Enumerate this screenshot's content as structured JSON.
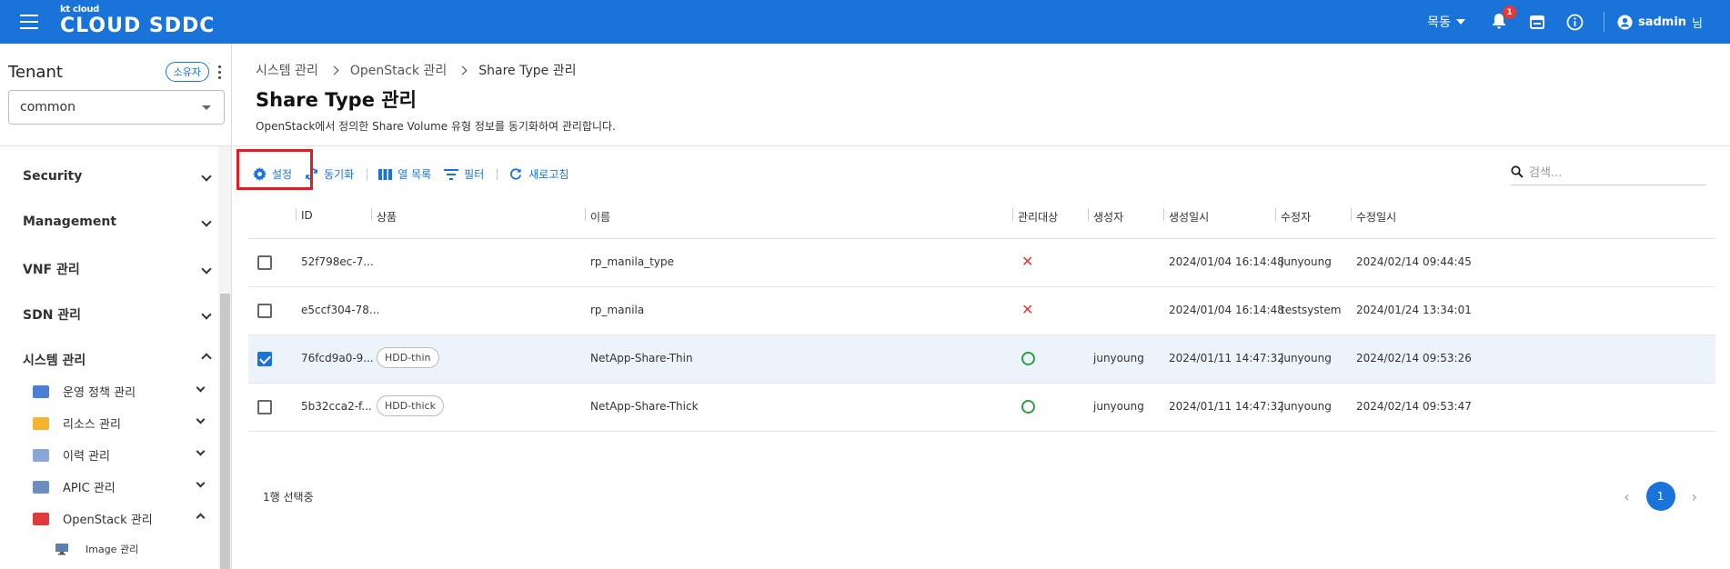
{
  "header": {
    "logo_small": "kt cloud",
    "logo_big": "CLOUD SDDC",
    "region": "목동",
    "notification_count": "1",
    "user_name": "sadmin",
    "user_suffix": "님"
  },
  "sidebar": {
    "tenant_title": "Tenant",
    "owner_chip": "소유자",
    "tenant_value": "common",
    "menus": [
      {
        "label": "Security"
      },
      {
        "label": "Management"
      },
      {
        "label": "VNF 관리"
      },
      {
        "label": "SDN 관리"
      },
      {
        "label": "시스템 관리"
      }
    ],
    "sub_items": [
      {
        "label": "운영 정책 관리",
        "icon": "policy-icon",
        "color": "#4a7fd4"
      },
      {
        "label": "리소스 관리",
        "icon": "folder-icon",
        "color": "#f2b431"
      },
      {
        "label": "이력 관리",
        "icon": "history-icon",
        "color": "#8aa6d6"
      },
      {
        "label": "APIC 관리",
        "icon": "monitor-icon",
        "color": "#6b8fbf"
      },
      {
        "label": "OpenStack 관리",
        "icon": "openstack-icon",
        "color": "#e03a3a"
      }
    ],
    "subsub_items": [
      {
        "label": "Image 관리",
        "icon": "image-icon"
      }
    ]
  },
  "breadcrumb": [
    "시스템 관리",
    "OpenStack 관리",
    "Share Type 관리"
  ],
  "page": {
    "title": "Share Type 관리",
    "description": "OpenStack에서 정의한 Share Volume 유형 정보를 동기화하여 관리합니다."
  },
  "toolbar": {
    "settings": "설정",
    "sync": "동기화",
    "columns": "열 목록",
    "filter": "필터",
    "refresh": "새로고침",
    "search_placeholder": "검색..."
  },
  "table": {
    "columns": [
      "ID",
      "상품",
      "이름",
      "관리대상",
      "생성자",
      "생성일시",
      "수정자",
      "수정일시"
    ],
    "rows": [
      {
        "id": "52f798ec-7...",
        "product": "",
        "name": "rp_manila_type",
        "managed": "no",
        "creator": "",
        "created": "2024/01/04 16:14:48",
        "modifier": "junyoung",
        "modified": "2024/02/14 09:44:45",
        "checked": false
      },
      {
        "id": "e5ccf304-78...",
        "product": "",
        "name": "rp_manila",
        "managed": "no",
        "creator": "",
        "created": "2024/01/04 16:14:48",
        "modifier": "testsystem",
        "modified": "2024/01/24 13:34:01",
        "checked": false
      },
      {
        "id": "76fcd9a0-9...",
        "product": "HDD-thin",
        "name": "NetApp-Share-Thin",
        "managed": "yes",
        "creator": "junyoung",
        "created": "2024/01/11 14:47:32",
        "modifier": "junyoung",
        "modified": "2024/02/14 09:53:26",
        "checked": true
      },
      {
        "id": "5b32cca2-f...",
        "product": "HDD-thick",
        "name": "NetApp-Share-Thick",
        "managed": "yes",
        "creator": "junyoung",
        "created": "2024/01/11 14:47:32",
        "modifier": "junyoung",
        "modified": "2024/02/14 09:53:47",
        "checked": false
      }
    ]
  },
  "footer": {
    "selection": "1행 선택중",
    "current_page": "1"
  }
}
